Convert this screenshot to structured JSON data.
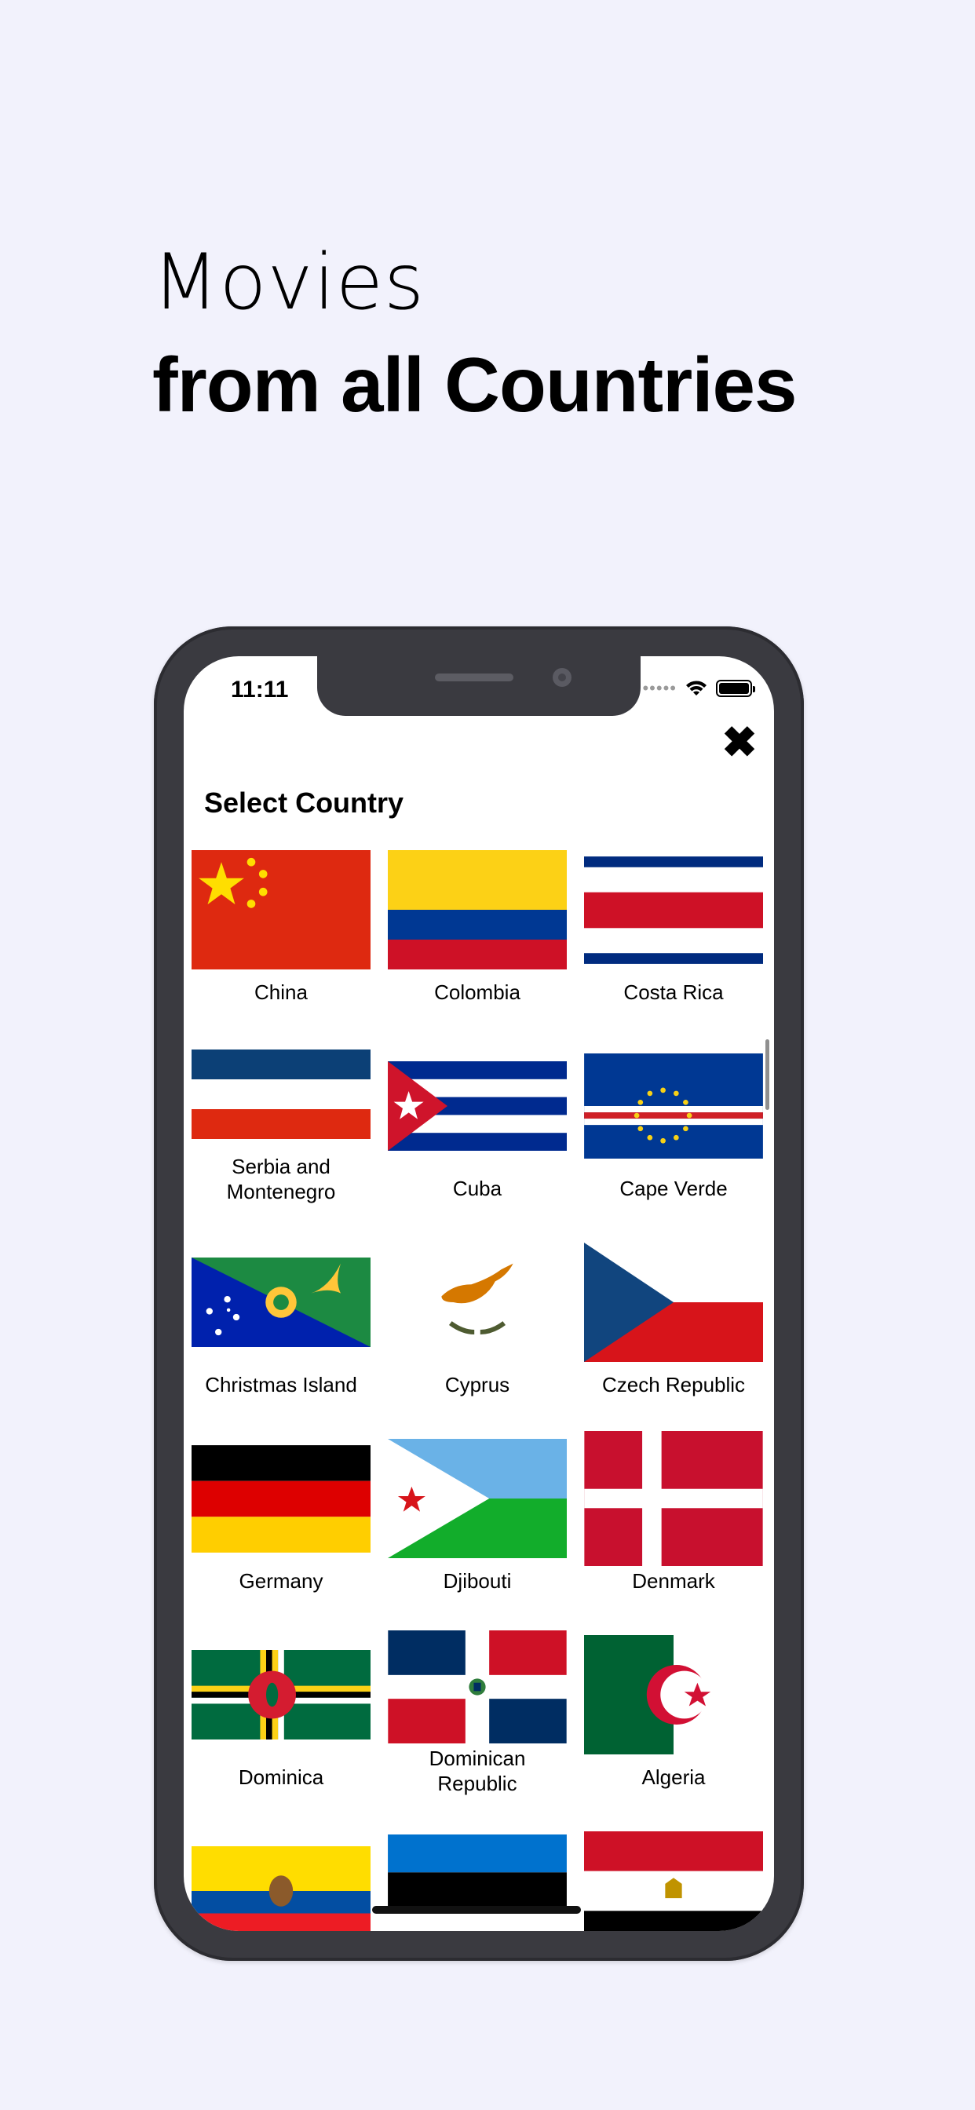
{
  "headline": {
    "line1": "Movies",
    "line2": "from all Countries"
  },
  "status_bar": {
    "time": "11:11",
    "signal_dots": "•••••"
  },
  "sheet": {
    "title": "Select Country",
    "close_glyph": "✖",
    "countries": [
      {
        "name": "China",
        "flag": "china-flag"
      },
      {
        "name": "Colombia",
        "flag": "colombia-flag"
      },
      {
        "name": "Costa Rica",
        "flag": "costa-rica-flag"
      },
      {
        "name": "Serbia and Montenegro",
        "flag": "serbia-montenegro-flag"
      },
      {
        "name": "Cuba",
        "flag": "cuba-flag"
      },
      {
        "name": "Cape Verde",
        "flag": "cape-verde-flag"
      },
      {
        "name": "Christmas Island",
        "flag": "christmas-island-flag"
      },
      {
        "name": "Cyprus",
        "flag": "cyprus-flag"
      },
      {
        "name": "Czech Republic",
        "flag": "czech-flag"
      },
      {
        "name": "Germany",
        "flag": "germany-flag"
      },
      {
        "name": "Djibouti",
        "flag": "djibouti-flag"
      },
      {
        "name": "Denmark",
        "flag": "denmark-flag"
      },
      {
        "name": "Dominica",
        "flag": "dominica-flag"
      },
      {
        "name": "Dominican Republic",
        "flag": "dominican-republic-flag"
      },
      {
        "name": "Algeria",
        "flag": "algeria-flag"
      },
      {
        "name": "",
        "flag": "ecuador-flag"
      },
      {
        "name": "",
        "flag": "estonia-flag"
      },
      {
        "name": "",
        "flag": "egypt-flag"
      }
    ]
  }
}
